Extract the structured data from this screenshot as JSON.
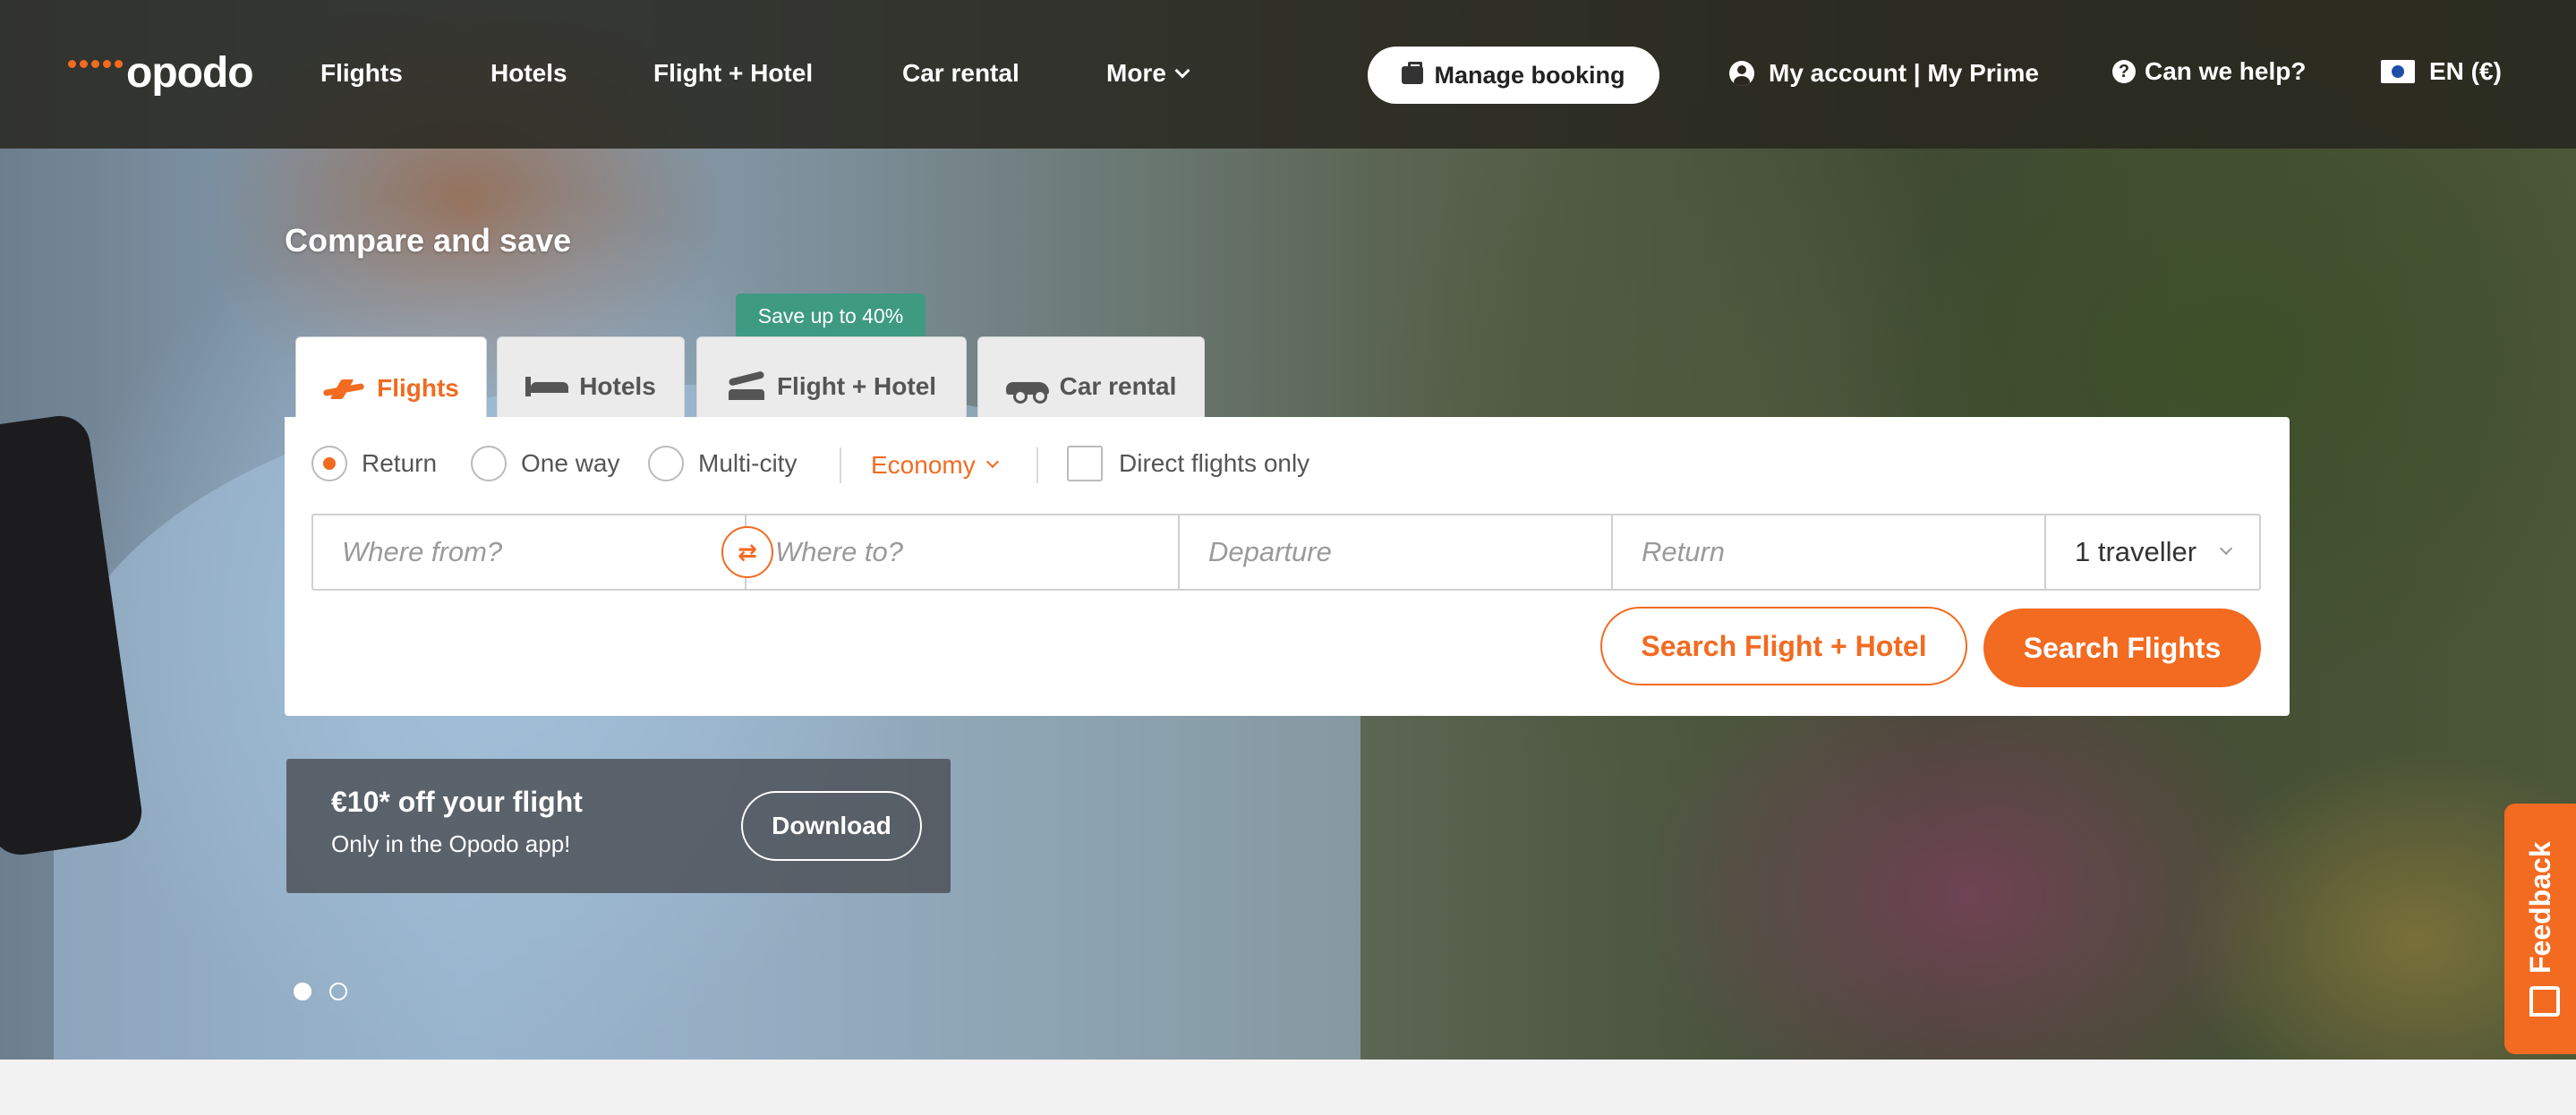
{
  "brand": {
    "name": "opodo",
    "accent": "#f26b21"
  },
  "nav": {
    "links": [
      "Flights",
      "Hotels",
      "Flight + Hotel",
      "Car rental",
      "More"
    ],
    "manage_booking": "Manage booking",
    "account": "My account | My Prime",
    "help": "Can we help?",
    "language": "EN (€)"
  },
  "hero": {
    "headline": "Compare and save",
    "tabs": [
      "Flights",
      "Hotels",
      "Flight + Hotel",
      "Car rental"
    ],
    "save_badge": "Save up to 40%"
  },
  "search": {
    "trip_types": [
      "Return",
      "One way",
      "Multi-city"
    ],
    "selected_trip_type": "Return",
    "cabin_class": "Economy",
    "direct_only_label": "Direct flights only",
    "from_placeholder": "Where from?",
    "to_placeholder": "Where to?",
    "departure_placeholder": "Departure",
    "return_placeholder": "Return",
    "travellers": "1 traveller",
    "search_flight_hotel": "Search Flight + Hotel",
    "search_flights": "Search Flights"
  },
  "promo": {
    "title": "€10* off your flight",
    "subtitle": "Only in the Opodo app!",
    "button": "Download"
  },
  "carousel": {
    "slides": 2,
    "active": 1
  },
  "feedback": {
    "label": "Feedback"
  }
}
